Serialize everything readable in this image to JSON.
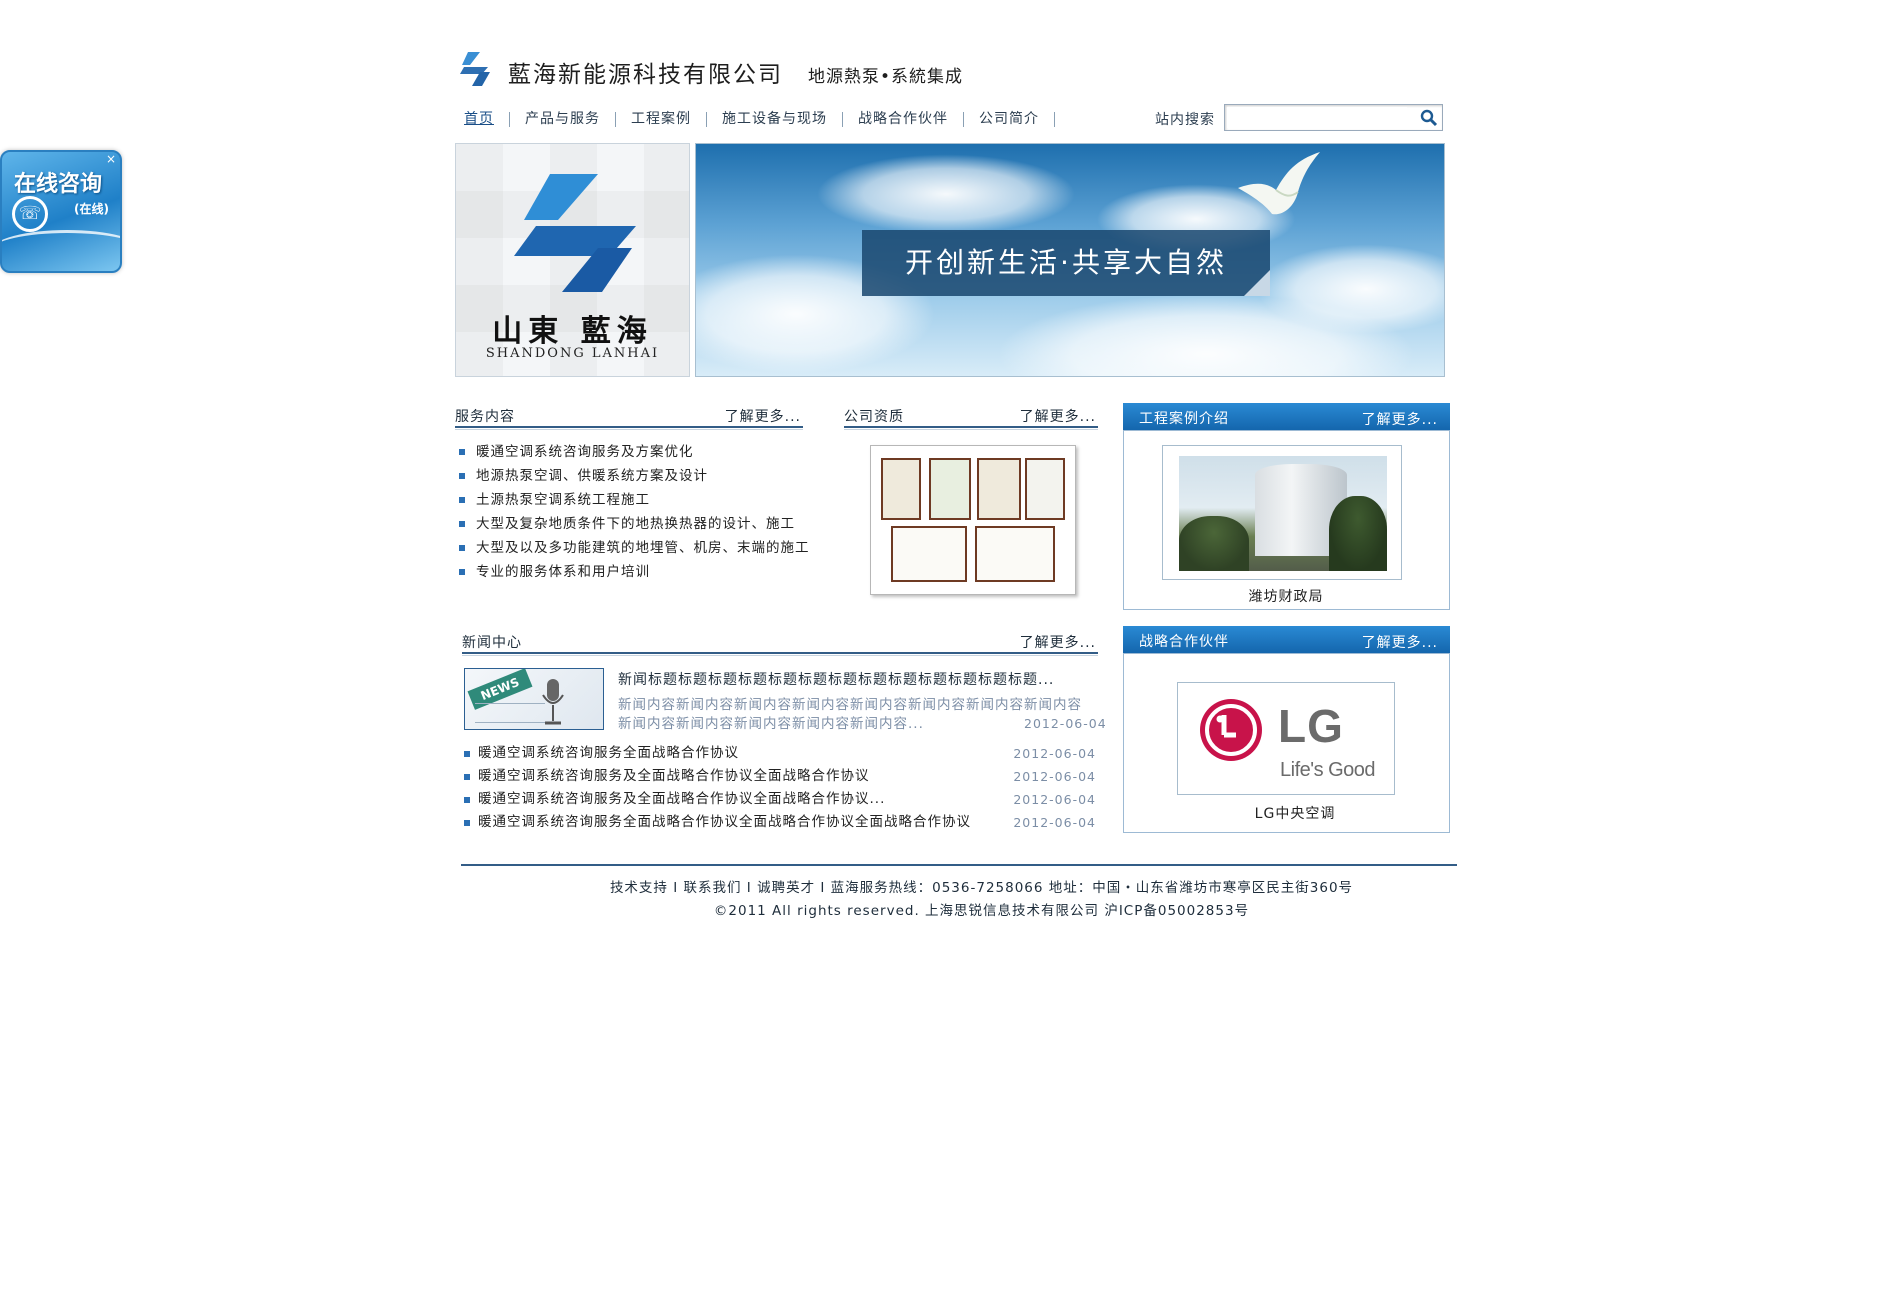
{
  "consult": {
    "title": "在线咨询",
    "status": "(在线)",
    "close": "×"
  },
  "header": {
    "company": "藍海新能源科技有限公司",
    "slogan": "地源熱泵•系統集成"
  },
  "nav": {
    "items": [
      "首页",
      "产品与服务",
      "工程案例",
      "施工设备与现场",
      "战略合作伙伴",
      "公司简介"
    ]
  },
  "search": {
    "label": "站内搜索",
    "value": "",
    "placeholder": ""
  },
  "banner": {
    "brand_cn": "山東 藍海",
    "brand_en": "SHANDONG LANHAI",
    "slogan": "开创新生活·共享大自然"
  },
  "services": {
    "title": "服务内容",
    "more": "了解更多...",
    "items": [
      "暖通空调系统咨询服务及方案优化",
      "地源热泵空调、供暖系统方案及设计",
      "土源热泵空调系统工程施工",
      "大型及复杂地质条件下的地热换热器的设计、施工",
      "大型及以及多功能建筑的地埋管、机房、末端的施工",
      "专业的服务体系和用户培训"
    ]
  },
  "qualification": {
    "title": "公司资质",
    "more": "了解更多..."
  },
  "cases": {
    "title": "工程案例介绍",
    "more": "了解更多...",
    "caption": "潍坊财政局"
  },
  "news": {
    "title": "新闻中心",
    "more": "了解更多...",
    "thumb_label": "NEWS",
    "featured_title": "新闻标题标题标题标题标题标题标题标题标题标题标题标题标题...",
    "featured_desc": "新闻内容新闻内容新闻内容新闻内容新闻内容新闻内容新闻内容新闻内容新闻内容新闻内容新闻内容新闻内容新闻内容...",
    "featured_date": "2012-06-04",
    "items": [
      {
        "text": "暖通空调系统咨询服务全面战略合作协议",
        "date": "2012-06-04"
      },
      {
        "text": "暖通空调系统咨询服务及全面战略合作协议全面战略合作协议",
        "date": "2012-06-04"
      },
      {
        "text": "暖通空调系统咨询服务及全面战略合作协议全面战略合作协议...",
        "date": "2012-06-04"
      },
      {
        "text": "暖通空调系统咨询服务全面战略合作协议全面战略合作协议全面战略合作协议",
        "date": "2012-06-04"
      }
    ]
  },
  "partners": {
    "title": "战略合作伙伴",
    "more": "了解更多...",
    "logo_text": "LG",
    "logo_tagline": "Life's Good",
    "caption": "LG中央空调"
  },
  "footer": {
    "line1": "技术支持 I 联系我们 I 诚聘英才 I 蓝海服务热线：0536-7258066  地址：中国・山东省潍坊市寒亭区民主街360号",
    "line2": "©2011 All rights reserved. 上海思锐信息技术有限公司 沪ICP备05002853号"
  },
  "colors": {
    "accent": "#1a6fb8",
    "nav_text": "#2c3e50",
    "muted": "#7c8ea6",
    "brand_red": "#c8134a"
  }
}
